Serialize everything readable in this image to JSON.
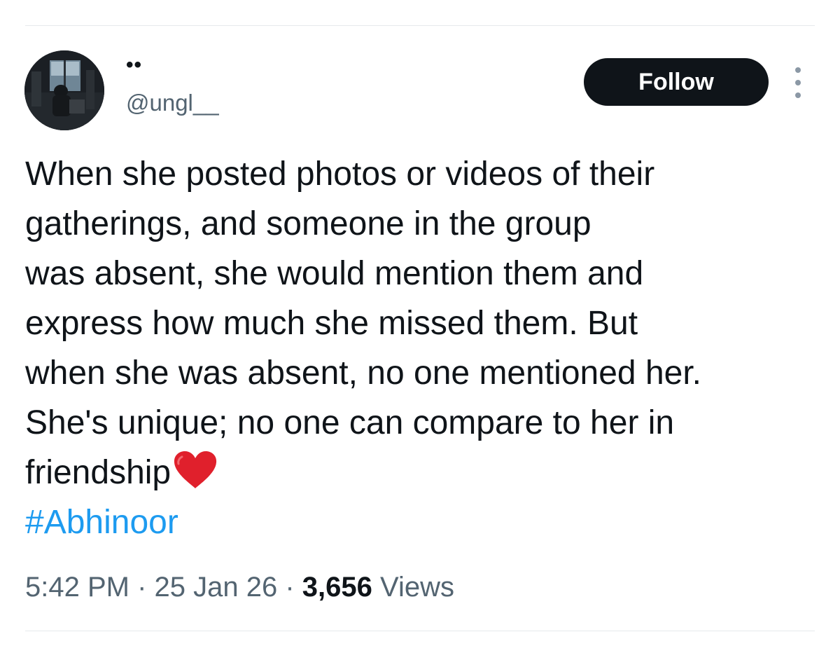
{
  "author": {
    "display_name": "••",
    "handle": "@ungl__"
  },
  "actions": {
    "follow_label": "Follow",
    "more_icon": "more-vertical-icon"
  },
  "tweet": {
    "lines": [
      "When she posted photos or videos of their",
      "gatherings, and someone in the group",
      "was absent, she would mention them and",
      "express how much she missed them. But",
      "when she was absent, no one mentioned her.",
      "She's unique; no one can compare to her in",
      "friendship"
    ],
    "emoji": "red-heart-icon",
    "hashtag": "#Abhinoor"
  },
  "meta": {
    "time": "5:42 PM",
    "separator": " · ",
    "date": "25 Jan 26",
    "views_count": "3,656",
    "views_label": " Views"
  },
  "colors": {
    "text": "#0f1419",
    "secondary": "#536471",
    "link": "#1d9bf0",
    "button": "#0f1419",
    "heart": "#e0202c"
  }
}
